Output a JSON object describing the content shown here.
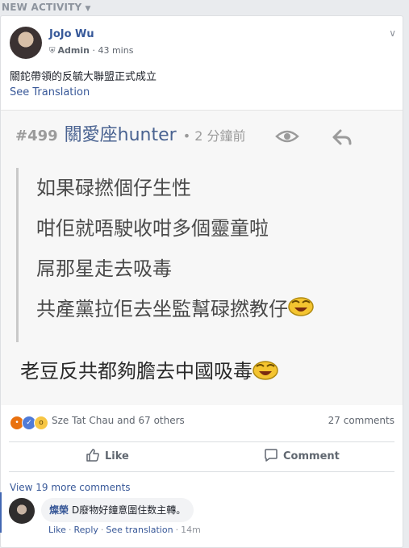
{
  "feed": {
    "header_label": "NEW ACTIVITY"
  },
  "post": {
    "author": "JoJo Wu",
    "role": "Admin",
    "time": "43 mins",
    "text": "關鉈帶領的反毓大聯盟正式成立",
    "see_translation": "See Translation"
  },
  "screenshot": {
    "post_number": "#499",
    "username": "關愛座hunter",
    "time": "• 2 分鐘前",
    "quote_lines": [
      "如果碌撚個仔生性",
      "咁佢就唔駛收咁多個靈童啦",
      "屌那星走去吸毒",
      "共產黨拉佢去坐監幫碌撚教仔"
    ],
    "footer": "老豆反共都夠膽去中國吸毒"
  },
  "reactions": {
    "names": "Sze Tat Chau and 67 others",
    "comment_count": "27 comments"
  },
  "actions": {
    "like_label": "Like",
    "comment_label": "Comment"
  },
  "comments": {
    "view_more": "View 19 more comments",
    "items": [
      {
        "author": "燦榮",
        "text": "D廢物好鐘意圍住数主轉。",
        "like": "Like",
        "reply": "Reply",
        "see_translation": "See translation",
        "time": "14m"
      }
    ]
  },
  "colors": {
    "link": "#385898",
    "author": "#365899",
    "background": "#e9ebee",
    "angry": "#e9710f",
    "like": "#4f7bd8",
    "wow": "#f7c644"
  },
  "icons": [
    "chevron-down-icon",
    "shield-icon",
    "eye-icon",
    "reply-arrow-icon",
    "laughing-emoji-icon",
    "thumbs-up-icon",
    "comment-bubble-icon"
  ]
}
